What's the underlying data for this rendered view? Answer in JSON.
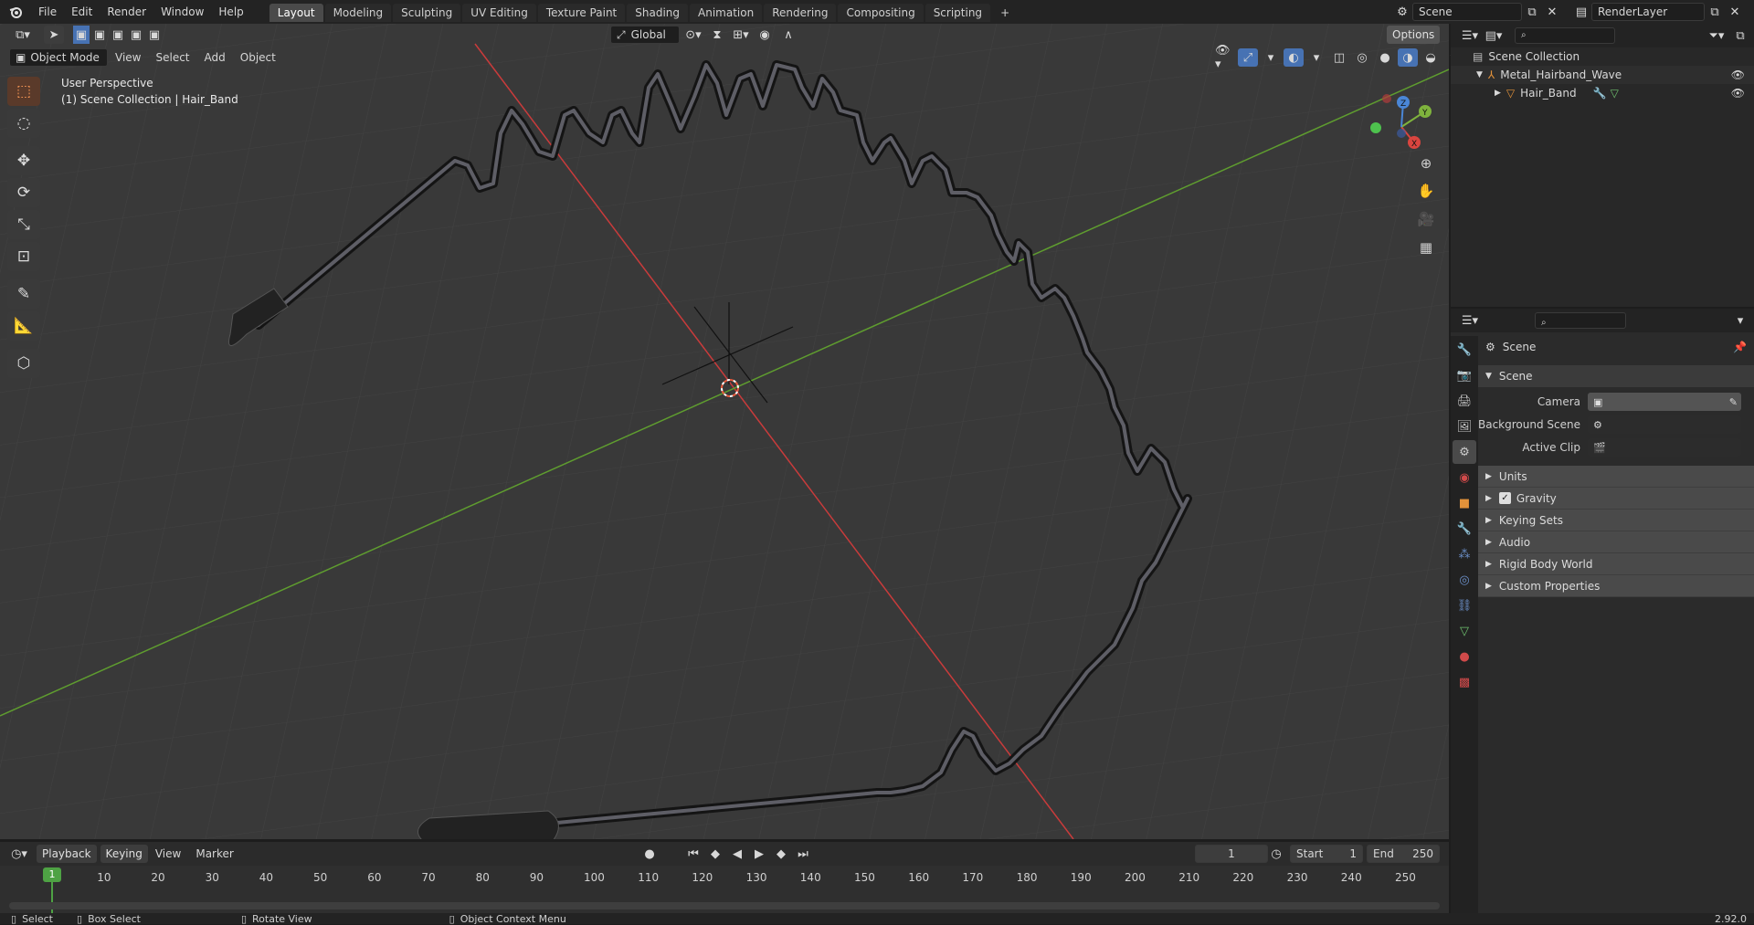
{
  "topbar": {
    "menus": [
      "File",
      "Edit",
      "Render",
      "Window",
      "Help"
    ],
    "workspaces": [
      "Layout",
      "Modeling",
      "Sculpting",
      "UV Editing",
      "Texture Paint",
      "Shading",
      "Animation",
      "Rendering",
      "Compositing",
      "Scripting"
    ],
    "active_workspace": "Layout",
    "add_tab": "+",
    "scene_name": "Scene",
    "view_layer": "RenderLayer"
  },
  "viewport_header": {
    "mode": "Object Mode",
    "menus": [
      "View",
      "Select",
      "Add",
      "Object"
    ],
    "transform_orientation": "Global",
    "options_label": "Options"
  },
  "viewport": {
    "view_name": "User Perspective",
    "collection_info": "(1) Scene Collection | Hair_Band",
    "axis_labels": {
      "x": "X",
      "y": "Y",
      "z": "Z"
    }
  },
  "toolbar": {
    "tools": [
      "select-box-icon",
      "cursor-icon",
      "move-icon",
      "rotate-icon",
      "scale-icon",
      "transform-icon",
      "annotate-icon",
      "measure-icon",
      "add-cube-icon"
    ]
  },
  "outliner": {
    "root": "Scene Collection",
    "collection": "Metal_Hairband_Wave",
    "object": "Hair_Band"
  },
  "properties": {
    "context_title": "Scene",
    "panel_title": "Scene",
    "fields": [
      {
        "label": "Camera",
        "value": ""
      },
      {
        "label": "Background Scene",
        "value": ""
      },
      {
        "label": "Active Clip",
        "value": ""
      }
    ],
    "subpanels": [
      "Units",
      "Gravity",
      "Keying Sets",
      "Audio",
      "Rigid Body World",
      "Custom Properties"
    ],
    "gravity_checked": true
  },
  "timeline": {
    "menus": [
      "Playback",
      "Keying",
      "View",
      "Marker"
    ],
    "current_frame": "1",
    "start_label": "Start",
    "start_value": "1",
    "end_label": "End",
    "end_value": "250",
    "frame_marks": [
      "10",
      "20",
      "30",
      "40",
      "50",
      "60",
      "70",
      "80",
      "90",
      "100",
      "110",
      "120",
      "130",
      "140",
      "150",
      "160",
      "170",
      "180",
      "190",
      "200",
      "210",
      "220",
      "230",
      "240",
      "250"
    ],
    "playhead_label": "1"
  },
  "statusbar": {
    "select": "Select",
    "box_select": "Box Select",
    "rotate_view": "Rotate View",
    "context_menu": "Object Context Menu",
    "version": "2.92.0"
  },
  "colors": {
    "accent": "#4772b3",
    "active_tool": "#ff9b57",
    "axis_x": "#d9453f",
    "axis_y": "#7fb33d",
    "axis_z": "#4a86d6"
  }
}
